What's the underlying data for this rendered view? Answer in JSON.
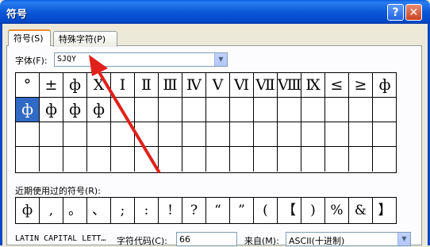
{
  "window": {
    "title": "符号",
    "help_glyph": "?",
    "close_glyph": "✕"
  },
  "tabs": [
    {
      "label": "符号(S)"
    },
    {
      "label": "特殊字符(P)"
    }
  ],
  "font": {
    "label": "字体(F):",
    "value": "SJQY"
  },
  "symbols": [
    [
      "°",
      "±",
      "ф",
      "Ⅹ",
      "Ⅰ",
      "Ⅱ",
      "Ⅲ",
      "Ⅳ",
      "Ⅴ",
      "Ⅵ",
      "Ⅶ",
      "Ⅷ",
      "Ⅸ",
      "≤",
      "≥",
      "ф"
    ],
    [
      "ф",
      "ф",
      "ф",
      "ф",
      "",
      "",
      "",
      "",
      "",
      "",
      "",
      "",
      "",
      "",
      "",
      ""
    ],
    [
      "",
      "",
      "",
      "",
      "",
      "",
      "",
      "",
      "",
      "",
      "",
      "",
      "",
      "",
      "",
      ""
    ],
    [
      "",
      "",
      "",
      "",
      "",
      "",
      "",
      "",
      "",
      "",
      "",
      "",
      "",
      "",
      "",
      ""
    ]
  ],
  "selected_symbol": [
    1,
    0
  ],
  "recent": {
    "label": "近期使用过的符号(R):",
    "items": [
      "ф",
      ",",
      "。",
      "、",
      ";",
      ":",
      "!",
      "?",
      "“",
      "”",
      "(",
      "【",
      ")",
      "%",
      "&",
      "】"
    ]
  },
  "bottom": {
    "char_name": "LATIN CAPITAL LETT…",
    "code_label": "字符代码(C):",
    "code_value": "66",
    "from_label": "来自(M):",
    "from_value": "ASCII(十进制)"
  },
  "colors": {
    "annotation_arrow": "#e0201a",
    "selection": "#316ac5"
  }
}
